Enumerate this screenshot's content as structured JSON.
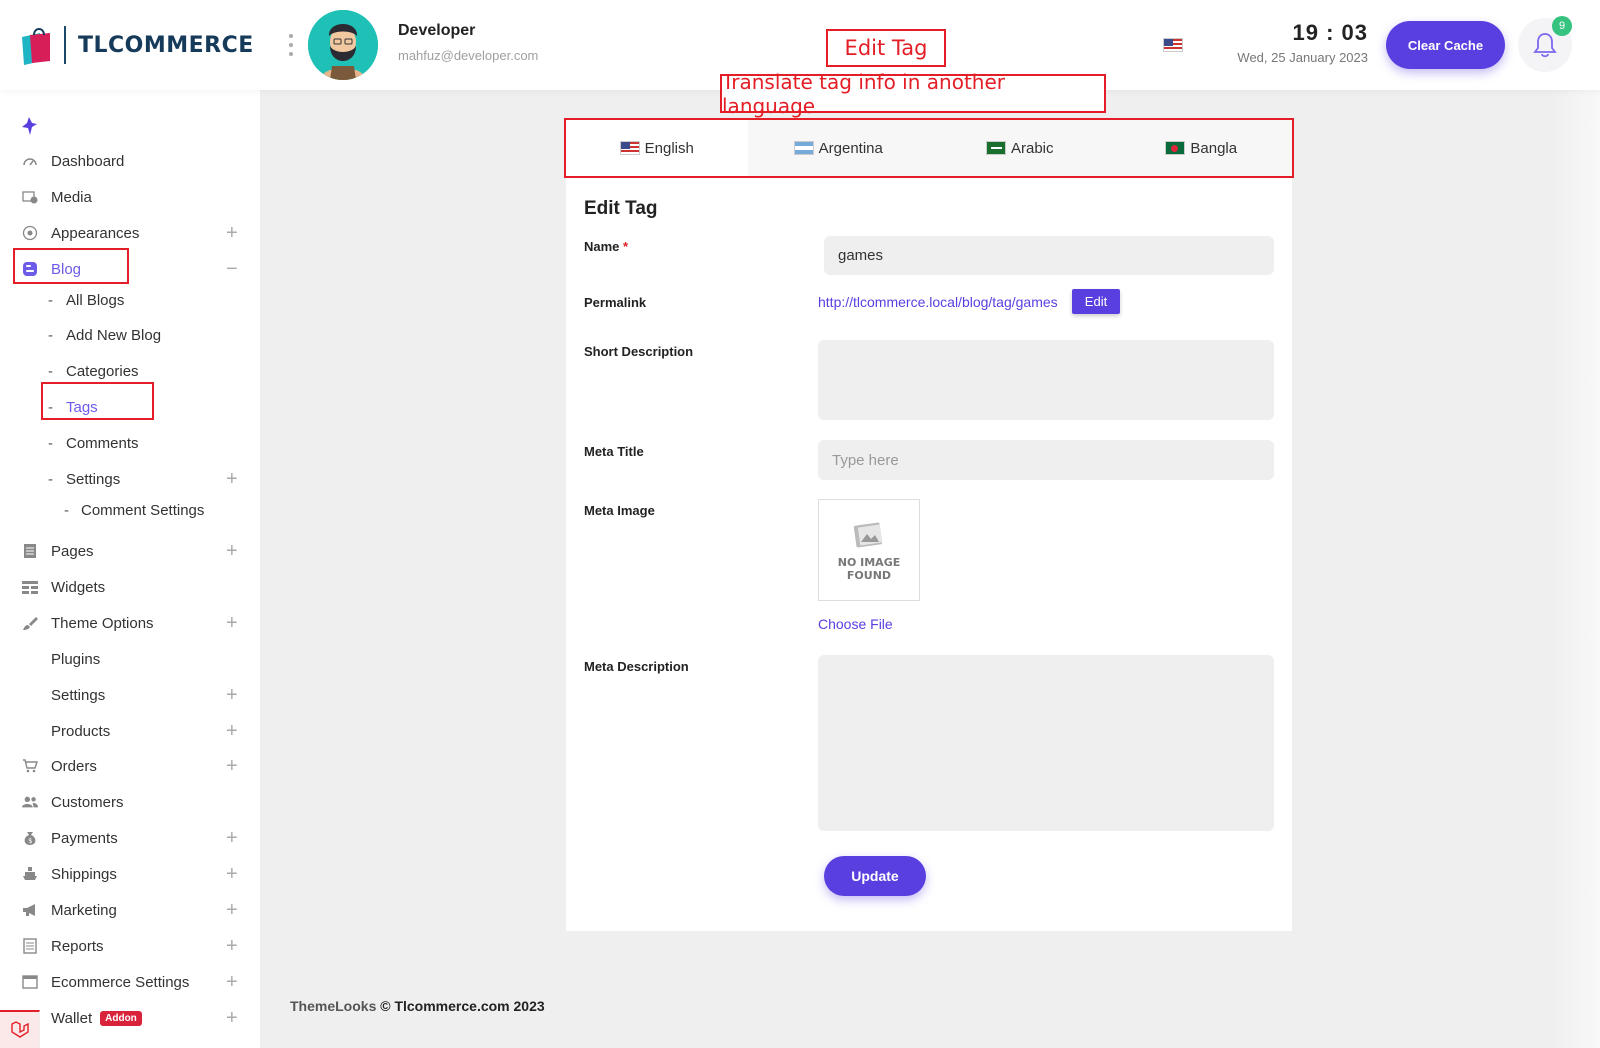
{
  "header": {
    "logo_text": "TLCOMMERCE",
    "user_name": "Developer",
    "user_email": "mahfuz@developer.com",
    "time": "19 : 03",
    "date": "Wed, 25 January 2023",
    "clear_cache_label": "Clear Cache",
    "notification_count": "9"
  },
  "annotations": {
    "edit_tag": "Edit Tag",
    "translate": "Translate tag info in another language"
  },
  "sidebar": {
    "items": [
      {
        "label": "Dashboard"
      },
      {
        "label": "Media"
      },
      {
        "label": "Appearances"
      },
      {
        "label": "Blog"
      },
      {
        "label": "All Blogs"
      },
      {
        "label": "Add New Blog"
      },
      {
        "label": "Categories"
      },
      {
        "label": "Tags"
      },
      {
        "label": "Comments"
      },
      {
        "label": "Settings"
      },
      {
        "label": "Comment Settings"
      },
      {
        "label": "Pages"
      },
      {
        "label": "Widgets"
      },
      {
        "label": "Theme Options"
      },
      {
        "label": "Plugins"
      },
      {
        "label": "Settings"
      },
      {
        "label": "Products"
      },
      {
        "label": "Orders"
      },
      {
        "label": "Customers"
      },
      {
        "label": "Payments"
      },
      {
        "label": "Shippings"
      },
      {
        "label": "Marketing"
      },
      {
        "label": "Reports"
      },
      {
        "label": "Ecommerce Settings"
      },
      {
        "label": "Wallet"
      }
    ],
    "addon_badge": "Addon"
  },
  "languages": [
    {
      "label": "English",
      "flag": "us-flag-icon"
    },
    {
      "label": "Argentina",
      "flag": "argentina-flag-icon"
    },
    {
      "label": "Arabic",
      "flag": "saudi-flag-icon"
    },
    {
      "label": "Bangla",
      "flag": "bangladesh-flag-icon"
    }
  ],
  "form": {
    "title": "Edit Tag",
    "name_label": "Name",
    "name_required": "*",
    "name_value": "games",
    "permalink_label": "Permalink",
    "permalink_url": "http://tlcommerce.local/blog/tag/games",
    "permalink_edit_label": "Edit",
    "short_description_label": "Short Description",
    "short_description_value": "",
    "meta_title_label": "Meta Title",
    "meta_title_placeholder": "Type here",
    "meta_image_label": "Meta Image",
    "no_image_line1": "NO IMAGE",
    "no_image_line2": "FOUND",
    "choose_file_label": "Choose File",
    "meta_description_label": "Meta Description",
    "meta_description_value": "",
    "update_label": "Update"
  },
  "footer": {
    "brand": "ThemeLooks",
    "copyright": "© Tlcommerce.com 2023"
  },
  "colors": {
    "accent": "#5a3fe0",
    "annotation": "#e41e26",
    "badge_green": "#36c37f"
  }
}
